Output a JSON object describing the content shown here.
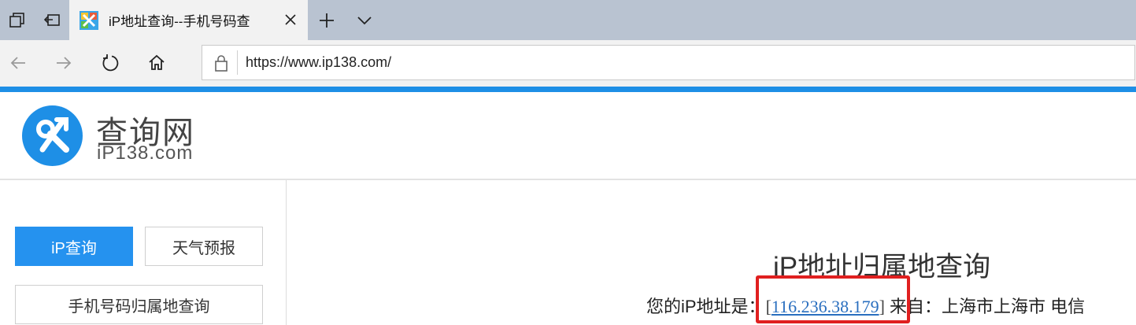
{
  "browser": {
    "tab": {
      "title": "iP地址查询--手机号码查"
    },
    "address": {
      "url": "https://www.ip138.com/"
    }
  },
  "site": {
    "logo_title": "查询网",
    "logo_subtitle": "iP138.com"
  },
  "sidebar": {
    "items": [
      {
        "label": "iP查询",
        "active": true
      },
      {
        "label": "天气预报",
        "active": false
      },
      {
        "label": "手机号码归属地查询",
        "active": false
      }
    ]
  },
  "main": {
    "title": "iP地址归属地查询",
    "ip_prefix": "您的iP地址是：",
    "ip_open_bracket": "[",
    "ip_address": "116.236.38.179",
    "ip_close_bracket": "]",
    "ip_suffix": " 来自：上海市上海市 电信"
  },
  "colors": {
    "accent_blue": "#1e8fe6",
    "button_blue": "#2592ef",
    "highlight_red": "#e02020",
    "tabstrip_bg": "#b9c3d1"
  }
}
